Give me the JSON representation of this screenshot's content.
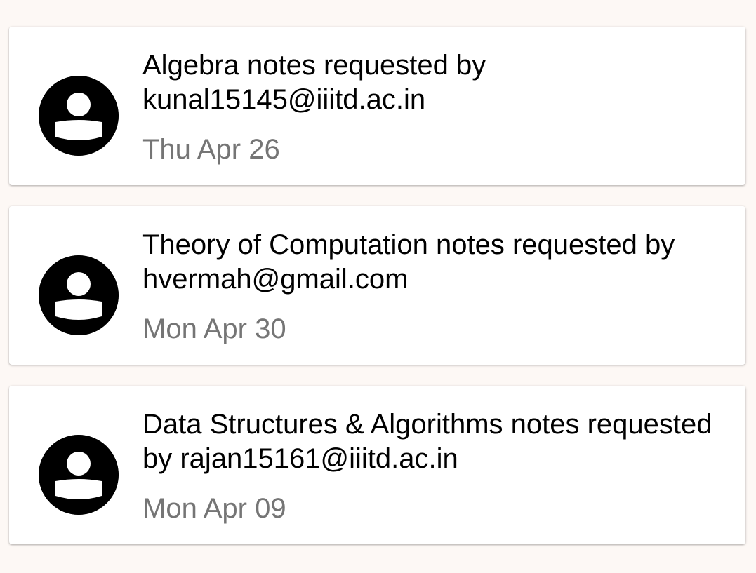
{
  "requests": [
    {
      "title": "Algebra notes requested by kunal15145@iiitd.ac.in",
      "date": "Thu Apr 26"
    },
    {
      "title": "Theory of Computation notes requested by hvermah@gmail.com",
      "date": "Mon Apr 30"
    },
    {
      "title": "Data Structures & Algorithms notes requested by rajan15161@iiitd.ac.in",
      "date": "Mon Apr 09"
    }
  ],
  "icons": {
    "avatar": "account-circle-icon"
  },
  "colors": {
    "background": "#fdf8f5",
    "card": "#ffffff",
    "title_text": "#000000",
    "date_text": "#757575"
  }
}
